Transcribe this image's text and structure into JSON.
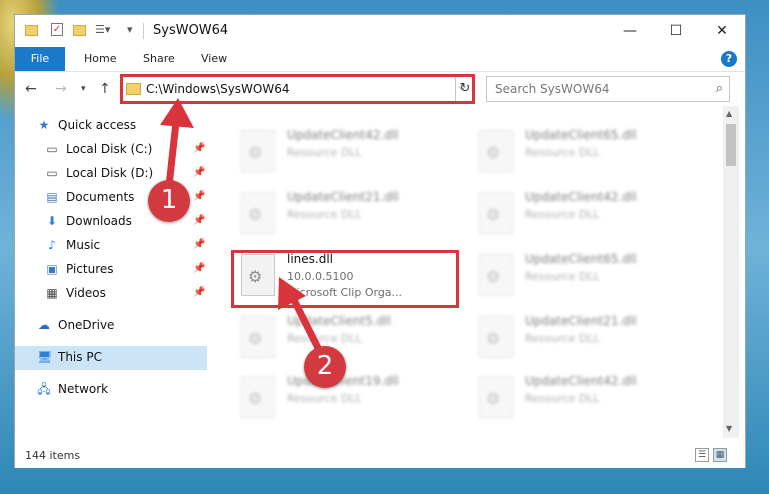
{
  "window": {
    "title": "SysWOW64"
  },
  "ribbon": {
    "tabs": [
      "File",
      "Home",
      "Share",
      "View"
    ],
    "help": "?"
  },
  "nav": {
    "address": "C:\\Windows\\SysWOW64",
    "search_placeholder": "Search SysWOW64"
  },
  "sidebar": {
    "items": [
      {
        "label": "Quick access",
        "icon": "star-icon"
      },
      {
        "label": "Local Disk (C:)",
        "icon": "drive-icon",
        "pinned": true
      },
      {
        "label": "Local Disk (D:)",
        "icon": "drive-icon",
        "pinned": true
      },
      {
        "label": "Documents",
        "icon": "documents-icon",
        "pinned": true
      },
      {
        "label": "Downloads",
        "icon": "downloads-icon",
        "pinned": true
      },
      {
        "label": "Music",
        "icon": "music-icon",
        "pinned": true
      },
      {
        "label": "Pictures",
        "icon": "pictures-icon",
        "pinned": true
      },
      {
        "label": "Videos",
        "icon": "videos-icon",
        "pinned": true
      },
      {
        "label": "OneDrive",
        "icon": "cloud-icon"
      },
      {
        "label": "This PC",
        "icon": "computer-icon",
        "selected": true
      },
      {
        "label": "Network",
        "icon": "network-icon"
      }
    ]
  },
  "files": [
    {
      "name": "UpdateClient42.dll",
      "line1": "Resource DLL",
      "line2": "",
      "blurred": true
    },
    {
      "name": "UpdateClient65.dll",
      "line1": "Resource DLL",
      "line2": "",
      "blurred": true
    },
    {
      "name": "UpdateClient21.dll",
      "line1": "Resource DLL",
      "line2": "",
      "blurred": true
    },
    {
      "name": "UpdateClient42.dll",
      "line1": "Resource DLL",
      "line2": "",
      "blurred": true
    },
    {
      "name": "lines.dll",
      "line1": "10.0.0.5100",
      "line2": "Microsoft Clip Orga...",
      "blurred": false
    },
    {
      "name": "UpdateClient65.dll",
      "line1": "Resource DLL",
      "line2": "",
      "blurred": true
    },
    {
      "name": "UpdateClient5.dll",
      "line1": "Resource DLL",
      "line2": "",
      "blurred": true
    },
    {
      "name": "UpdateClient21.dll",
      "line1": "Resource DLL",
      "line2": "",
      "blurred": true
    },
    {
      "name": "UpdateClient19.dll",
      "line1": "Resource DLL",
      "line2": "",
      "blurred": true
    },
    {
      "name": "UpdateClient42.dll",
      "line1": "Resource DLL",
      "line2": "",
      "blurred": true
    }
  ],
  "status": {
    "count": "144 items"
  },
  "annotations": {
    "step1": "1",
    "step2": "2",
    "color": "#d9343c"
  }
}
